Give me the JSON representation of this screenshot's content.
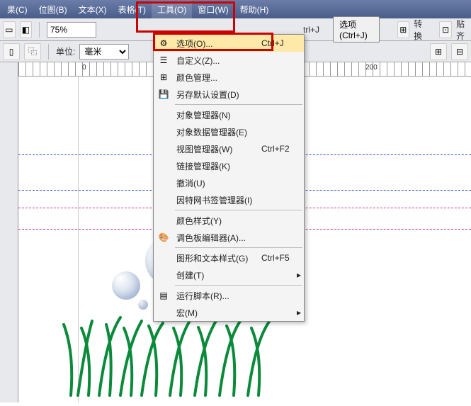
{
  "menubar": {
    "items": [
      {
        "label": "果(C)"
      },
      {
        "label": "位图(B)"
      },
      {
        "label": "文本(X)"
      },
      {
        "label": "表格(T)"
      },
      {
        "label": "工具(O)"
      },
      {
        "label": "窗口(W)"
      },
      {
        "label": "帮助(H)"
      }
    ]
  },
  "toolbar1": {
    "zoom": "75%",
    "options_btn": "选项 (Ctrl+J)",
    "transform": "转换",
    "align": "贴齐"
  },
  "toolbar2": {
    "unit_label": "单位:",
    "unit_value": "毫米"
  },
  "ruler": {
    "ticks": [
      "0",
      "200"
    ]
  },
  "dropdown": {
    "items": [
      {
        "label": "选项(O)...",
        "shortcut": "Ctrl+J",
        "icon": "options-icon",
        "hi": true
      },
      {
        "label": "自定义(Z)...",
        "icon": "customize-icon"
      },
      {
        "label": "颜色管理...",
        "icon": "color-mgmt-icon"
      },
      {
        "label": "另存默认设置(D)",
        "icon": "save-icon"
      },
      {
        "sep": true
      },
      {
        "label": "对象管理器(N)"
      },
      {
        "label": "对象数据管理器(E)"
      },
      {
        "label": "视图管理器(W)",
        "shortcut": "Ctrl+F2"
      },
      {
        "label": "链接管理器(K)"
      },
      {
        "label": "撤消(U)"
      },
      {
        "label": "因特网书签管理器(I)"
      },
      {
        "sep": true
      },
      {
        "label": "颜色样式(Y)"
      },
      {
        "label": "调色板编辑器(A)...",
        "icon": "palette-icon"
      },
      {
        "sep": true
      },
      {
        "label": "图形和文本样式(G)",
        "shortcut": "Ctrl+F5"
      },
      {
        "label": "创建(T)",
        "arrow": true
      },
      {
        "sep": true
      },
      {
        "label": "运行脚本(R)...",
        "icon": "script-icon"
      },
      {
        "label": "宏(M)",
        "arrow": true
      }
    ]
  },
  "shortcut_visible": "trl+J"
}
